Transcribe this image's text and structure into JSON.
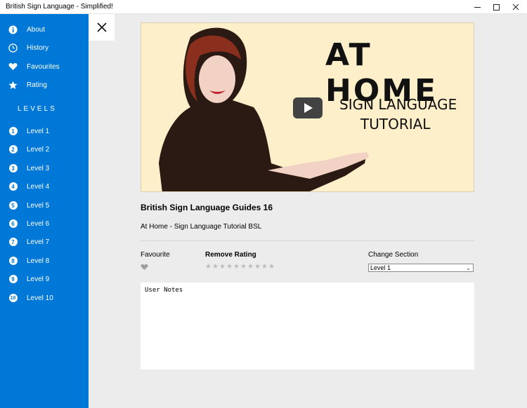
{
  "window": {
    "title": "British Sign Language - Simplified!",
    "controls": [
      "minimize",
      "maximize",
      "close"
    ]
  },
  "sidebar": {
    "items": [
      {
        "label": "About",
        "icon": "info-icon"
      },
      {
        "label": "History",
        "icon": "clock-icon"
      },
      {
        "label": "Favourites",
        "icon": "heart-icon"
      },
      {
        "label": "Rating",
        "icon": "star-icon"
      }
    ],
    "section_header": "LEVELS",
    "levels": [
      {
        "num": "1",
        "label": "Level 1"
      },
      {
        "num": "2",
        "label": "Level 2"
      },
      {
        "num": "3",
        "label": "Level 3"
      },
      {
        "num": "4",
        "label": "Level 4"
      },
      {
        "num": "5",
        "label": "Level 5"
      },
      {
        "num": "6",
        "label": "Level 6"
      },
      {
        "num": "7",
        "label": "Level 7"
      },
      {
        "num": "8",
        "label": "Level 8"
      },
      {
        "num": "9",
        "label": "Level 9"
      },
      {
        "num": "10",
        "label": "Level 10"
      }
    ]
  },
  "video": {
    "thumbnail_text_1": "AT HOME",
    "thumbnail_text_2": "SIGN LANGUAGE",
    "thumbnail_text_3": "TUTORIAL"
  },
  "details": {
    "title": "British Sign Language Guides 16",
    "subtitle": "At Home - Sign Language Tutorial BSL",
    "favourite_label": "Favourite",
    "rating_label": "Remove Rating",
    "rating_stars_total": 10,
    "rating_value": 0,
    "section_label": "Change Section",
    "section_selected": "Level 1",
    "notes_text": "User Notes"
  },
  "colors": {
    "accent": "#0078d7",
    "background": "#ececec",
    "star_inactive": "#bdbdbd",
    "heart_inactive": "#9e9e9e",
    "video_bg": "#fcefc9"
  }
}
